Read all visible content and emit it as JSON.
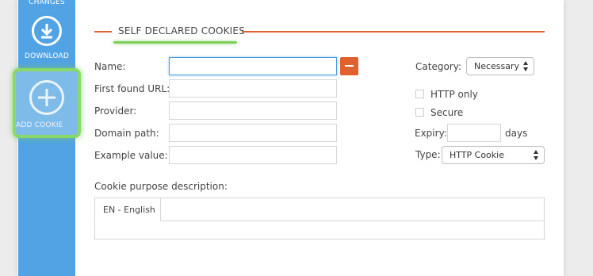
{
  "sidebar": {
    "changes_label": "CHANGES",
    "download_label": "DOWNLOAD",
    "add_cookie_label": "ADD COOKIE",
    "download_icon": "download-icon",
    "add_cookie_icon": "plus-circle-icon"
  },
  "section": {
    "title": "SELF DECLARED COOKIES",
    "accent_color": "#e0622e",
    "highlight_color": "#7cd05a"
  },
  "form": {
    "name_label": "Name:",
    "first_found_url_label": "First found URL:",
    "provider_label": "Provider:",
    "domain_path_label": "Domain path:",
    "example_value_label": "Example value:",
    "name_value": "",
    "first_found_url_value": "",
    "provider_value": "",
    "domain_path_value": "",
    "example_value_value": ""
  },
  "right": {
    "category_label": "Category:",
    "category_value": "Necessary",
    "http_only_label": "HTTP only",
    "secure_label": "Secure",
    "expiry_label": "Expiry:",
    "expiry_value": "",
    "expiry_unit": "days",
    "type_label": "Type:",
    "type_value": "HTTP Cookie"
  },
  "description": {
    "label": "Cookie purpose description:",
    "tab_label": "EN - English",
    "text": ""
  }
}
